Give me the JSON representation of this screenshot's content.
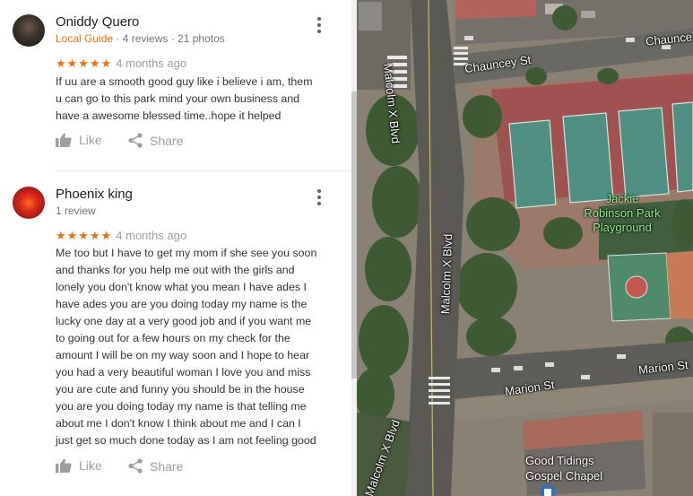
{
  "reviews": [
    {
      "name": "Oniddy Quero",
      "badge": "Local Guide",
      "stats": " · 4 reviews · 21 photos",
      "stars": "★★★★★",
      "age": "4 months ago",
      "lines": [
        "If uu are a smooth good guy like i believe i am, them",
        "u can go to this park mind your own business and",
        "have a awesome blessed time..hope it helped"
      ],
      "like_label": "Like",
      "share_label": "Share"
    },
    {
      "name": "Phoenix king",
      "stats": "1 review",
      "stars": "★★★★★",
      "age": "4 months ago",
      "lines": [
        "Me too but I have to get my mom if she see you soon",
        "and thanks for you help me out with the girls and",
        "lonely you don't know what you mean I have ades I",
        "have ades you are you doing today my name is the",
        "lucky one day at a very good job and if you want me",
        "to going out for a few hours on my check for the",
        "amount I will be on my way soon and I hope to hear",
        "you had a very beautiful woman I love you and miss",
        "you are cute and funny you should be in the house",
        "you are you doing today my name is that telling me",
        "about me I don't know I think about me and I can I",
        "just get so much done today as I am not feeling good"
      ],
      "like_label": "Like",
      "share_label": "Share"
    }
  ],
  "map": {
    "streets": {
      "malcolm_1": "Malcolm X Blvd",
      "malcolm_2": "Malcolm X Blvd",
      "malcolm_3": "Malcolm X Blvd",
      "chauncey_1": "Chauncey St",
      "chauncey_2": "Chaunce",
      "marion_1": "Marion St",
      "marion_2": "Marion St"
    },
    "park": [
      "Jackie",
      "Robinson Park",
      "Playground"
    ],
    "chapel": [
      "Good Tidings",
      "Gospel Chapel"
    ]
  },
  "colors": {
    "accent": "#e8710a",
    "muted": "#9e9e9e",
    "park_label": "#8ff08a"
  },
  "icons": {
    "like": "thumbs-up-icon",
    "share": "share-icon",
    "more": "more-vert-icon",
    "place": "place-pin-icon"
  }
}
